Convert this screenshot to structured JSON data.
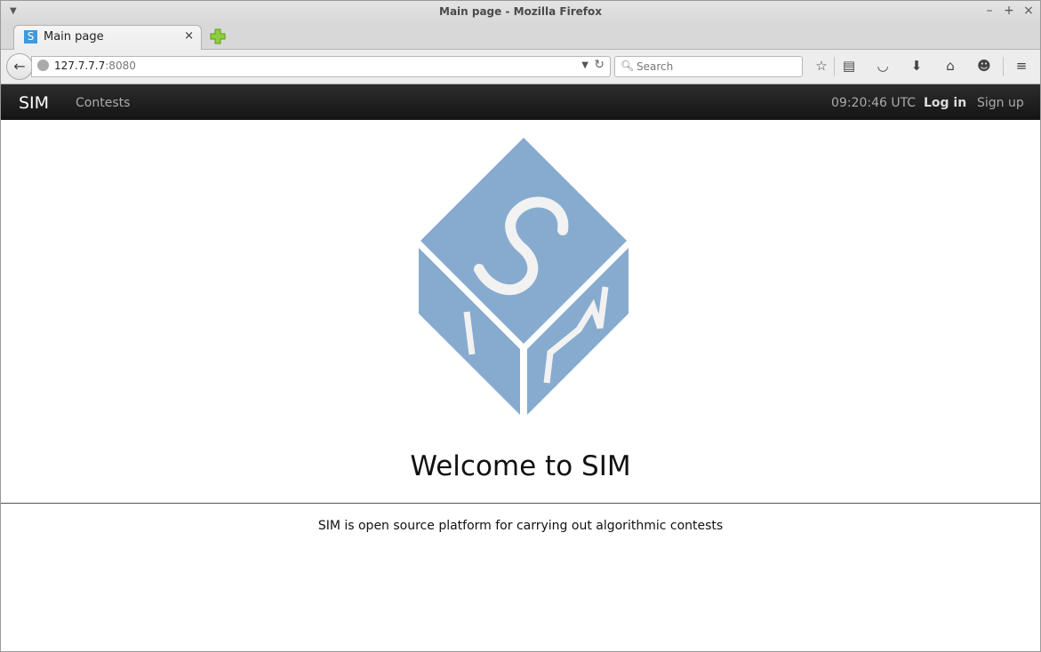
{
  "window": {
    "title": "Main page - Mozilla Firefox"
  },
  "tab": {
    "label": "Main page",
    "favicon_letter": "S",
    "close_glyph": "×"
  },
  "address_bar": {
    "host": "127.7.7.7",
    "port": ":8080"
  },
  "search_bar": {
    "placeholder": "Search"
  },
  "toolbar_icons": [
    "star-icon",
    "reading-list-icon",
    "pocket-icon",
    "download-icon",
    "home-icon",
    "smiley-icon",
    "hamburger-menu-icon"
  ],
  "site_nav": {
    "brand": "SIM",
    "links": [
      "Contests"
    ],
    "clock": "09:20:46 UTC",
    "login": "Log in",
    "signup": "Sign up"
  },
  "main": {
    "logo_color": "#87abcf",
    "heading": "Welcome to SIM",
    "tagline": "SIM is open source platform for carrying out algorithmic contests"
  }
}
